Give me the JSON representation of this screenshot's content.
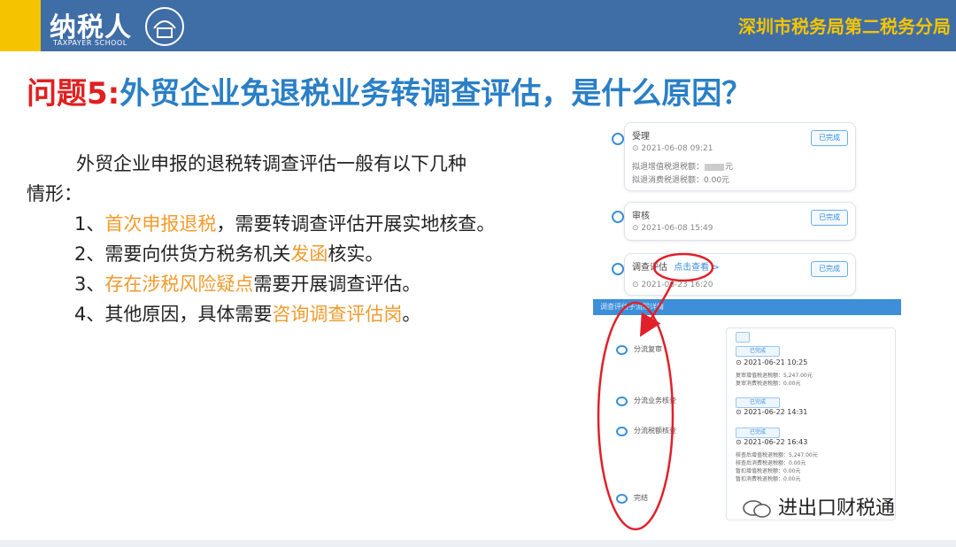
{
  "header": {
    "logo_text": "纳税人",
    "logo_badge": "学堂",
    "logo_subtitle": "TAXPAYER SCHOOL",
    "bureau": "深圳市税务局第二税务分局"
  },
  "title": {
    "prefix": "问题5:",
    "text": "外贸企业免退税业务转调查评估，是什么原因？"
  },
  "body": {
    "intro_line1": "外贸企业申报的退税转调查评估一般有以下几种",
    "intro_line2": "情形：",
    "items": [
      {
        "num": "1、",
        "highlight": "首次申报退税",
        "rest": "，需要转调查评估开展实地核查。"
      },
      {
        "num": "2、",
        "pre": "需要向供货方税务机关",
        "highlight": "发函",
        "rest": "核实。"
      },
      {
        "num": "3、",
        "highlight": "存在涉税风险疑点",
        "rest": "需要开展调查评估。"
      },
      {
        "num": "4、",
        "pre": "其他原因，具体需要",
        "highlight": "咨询调查评估岗",
        "rest": "。"
      }
    ]
  },
  "screenshot": {
    "stages": [
      {
        "name": "受理",
        "time": "2021-06-08 09:21",
        "line1": "拟退增值税退税额：",
        "line1_value": "元",
        "line2": "拟退消费税退税额：0.00元",
        "status": "已完成"
      },
      {
        "name": "审核",
        "time": "2021-06-08 15:49",
        "status": "已完成"
      },
      {
        "name": "调查评估",
        "link": "点击查看 >",
        "time": "2021-06-23 16:20",
        "status": "已完成"
      }
    ],
    "subpanel": {
      "bar": "调查评估子流程详情",
      "steps": [
        "分流复审",
        "分流业务核查",
        "分流税额核查",
        "完结"
      ],
      "records": [
        {
          "tag": "已完成",
          "time": "2021-06-21 10:25",
          "lines": [
            "复审增值税退税额：5,247.00元",
            "复审消费税退税额：0.00元"
          ]
        },
        {
          "tag": "已完成",
          "time": "2021-06-22 14:31",
          "lines": []
        },
        {
          "tag": "已完成",
          "time": "2021-06-22 16:43",
          "lines": [
            "核查后增值税退税额：5,247.00元",
            "核查后消费税退税额：0.00元",
            "暂扣增值税退税额：0.00元",
            "暂扣消费税退税额：0.00元"
          ]
        }
      ]
    }
  },
  "watermark": "进出口财税通",
  "colors": {
    "header_blue": "#3f6da6",
    "accent_yellow": "#f5c400",
    "title_red": "#e02020",
    "title_blue": "#2a7fc6",
    "highlight_orange": "#f39a2c",
    "annotation_red": "#e0202a"
  }
}
